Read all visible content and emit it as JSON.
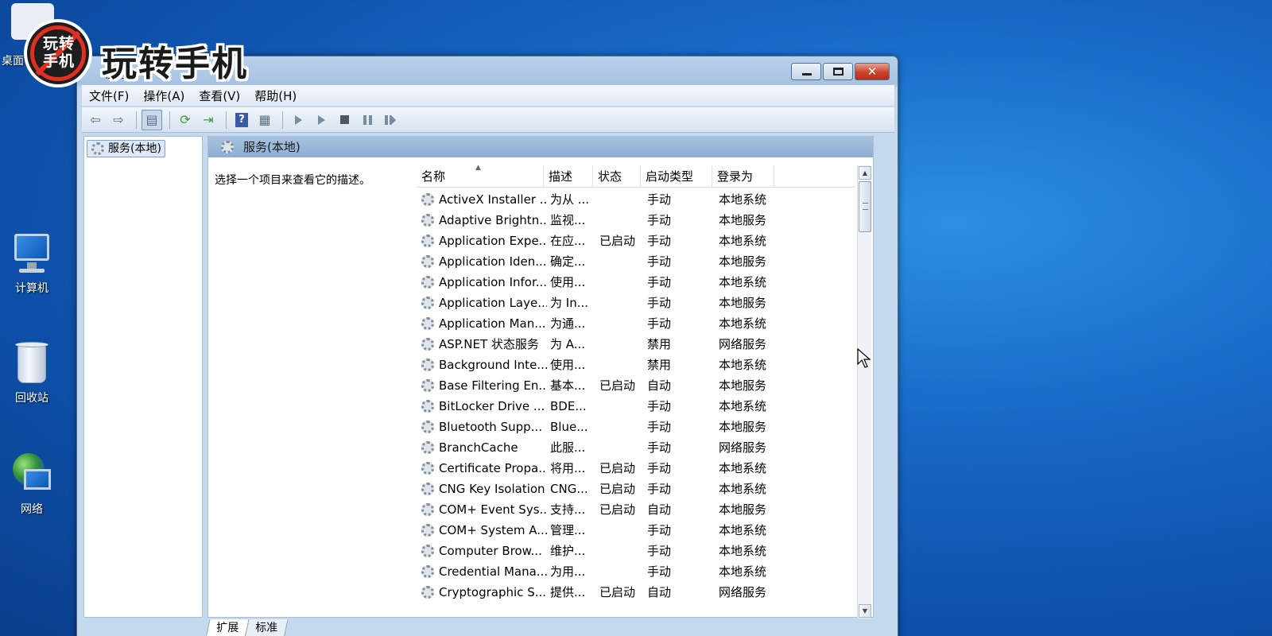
{
  "watermark": {
    "badge_text": "玩转手机",
    "title": "玩转手机"
  },
  "desktop": {
    "top_icon_label": "桌面",
    "icons": [
      {
        "label": "计算机",
        "icon": "computer-icon"
      },
      {
        "label": "回收站",
        "icon": "recycle-bin-icon"
      },
      {
        "label": "网络",
        "icon": "network-icon"
      }
    ]
  },
  "window": {
    "title": "服务",
    "controls": {
      "minimize": "minimize",
      "maximize": "maximize",
      "close": "✕"
    },
    "menu": [
      "文件(F)",
      "操作(A)",
      "查看(V)",
      "帮助(H)"
    ],
    "toolbar_icons": [
      "back-arrow-icon",
      "forward-arrow-icon",
      "show-hide-tree-icon",
      "refresh-icon",
      "export-list-icon",
      "help-icon",
      "properties-icon",
      "start-service-icon",
      "start-service-alt-icon",
      "stop-service-icon",
      "pause-service-icon",
      "restart-service-icon"
    ],
    "tree": {
      "selected_item": "服务(本地)"
    },
    "pane_header": "服务(本地)",
    "description_prompt": "选择一个项目来查看它的描述。",
    "columns": {
      "name": "名称",
      "description": "描述",
      "status": "状态",
      "startup_type": "启动类型",
      "logon_as": "登录为"
    },
    "rows": [
      {
        "name": "ActiveX Installer ...",
        "desc": "为从 ...",
        "status": "",
        "startup": "手动",
        "logon": "本地系统"
      },
      {
        "name": "Adaptive Brightn...",
        "desc": "监视...",
        "status": "",
        "startup": "手动",
        "logon": "本地服务"
      },
      {
        "name": "Application Expe...",
        "desc": "在应...",
        "status": "已启动",
        "startup": "手动",
        "logon": "本地系统"
      },
      {
        "name": "Application Iden...",
        "desc": "确定...",
        "status": "",
        "startup": "手动",
        "logon": "本地服务"
      },
      {
        "name": "Application Infor...",
        "desc": "使用...",
        "status": "",
        "startup": "手动",
        "logon": "本地系统"
      },
      {
        "name": "Application Laye...",
        "desc": "为 In...",
        "status": "",
        "startup": "手动",
        "logon": "本地服务"
      },
      {
        "name": "Application Man...",
        "desc": "为通...",
        "status": "",
        "startup": "手动",
        "logon": "本地系统"
      },
      {
        "name": "ASP.NET 状态服务",
        "desc": "为 A...",
        "status": "",
        "startup": "禁用",
        "logon": "网络服务"
      },
      {
        "name": "Background Inte...",
        "desc": "使用...",
        "status": "",
        "startup": "禁用",
        "logon": "本地系统"
      },
      {
        "name": "Base Filtering En...",
        "desc": "基本...",
        "status": "已启动",
        "startup": "自动",
        "logon": "本地服务"
      },
      {
        "name": "BitLocker Drive ...",
        "desc": "BDE...",
        "status": "",
        "startup": "手动",
        "logon": "本地系统"
      },
      {
        "name": "Bluetooth Supp...",
        "desc": "Blue...",
        "status": "",
        "startup": "手动",
        "logon": "本地服务"
      },
      {
        "name": "BranchCache",
        "desc": "此服...",
        "status": "",
        "startup": "手动",
        "logon": "网络服务"
      },
      {
        "name": "Certificate Propa...",
        "desc": "将用...",
        "status": "已启动",
        "startup": "手动",
        "logon": "本地系统"
      },
      {
        "name": "CNG Key Isolation",
        "desc": "CNG...",
        "status": "已启动",
        "startup": "手动",
        "logon": "本地系统"
      },
      {
        "name": "COM+ Event Sys...",
        "desc": "支持...",
        "status": "已启动",
        "startup": "自动",
        "logon": "本地服务"
      },
      {
        "name": "COM+ System A...",
        "desc": "管理...",
        "status": "",
        "startup": "手动",
        "logon": "本地系统"
      },
      {
        "name": "Computer Brow...",
        "desc": "维护...",
        "status": "",
        "startup": "手动",
        "logon": "本地系统"
      },
      {
        "name": "Credential Mana...",
        "desc": "为用...",
        "status": "",
        "startup": "手动",
        "logon": "本地系统"
      },
      {
        "name": "Cryptographic S...",
        "desc": "提供...",
        "status": "已启动",
        "startup": "自动",
        "logon": "网络服务"
      }
    ],
    "tabs": [
      "扩展",
      "标准"
    ],
    "selected_tab": "扩展"
  }
}
